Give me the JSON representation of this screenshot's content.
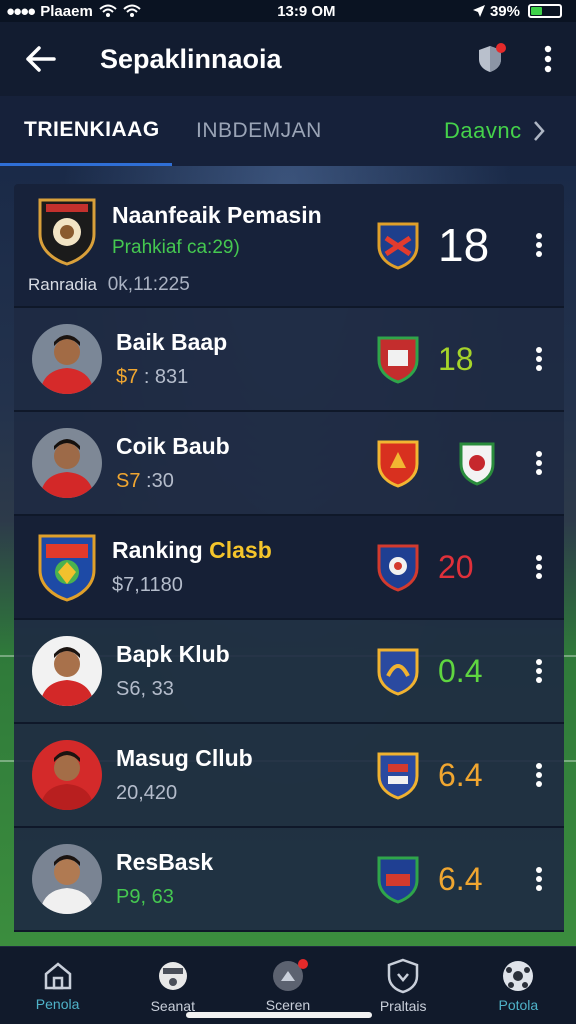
{
  "status": {
    "carrier": "Plaaem",
    "time": "13:9 OM",
    "battery": "39%",
    "battery_level": 0.39
  },
  "appbar": {
    "title": "Sepaklinnaoia",
    "notification_badge": true
  },
  "tabs": [
    {
      "label": "TRIENKIAAG",
      "active": true
    },
    {
      "label": "INBDEMJAN",
      "active": false
    }
  ],
  "tab_link": "Daavnc",
  "list": {
    "featured": {
      "name": "Naanfeaik Pemasin",
      "subtitle": "Prahkiaf ca:29)",
      "footer_label": "Ranradia",
      "footer_value": "0k,11:225",
      "score": "18",
      "score_color": "#ffffff"
    },
    "rows": [
      {
        "name": "Baik Baap",
        "sub_prefix": "$7",
        "sub_value": ": 831",
        "score": "18",
        "score_color": "#a6d42a"
      },
      {
        "name": "Coik Baub",
        "sub_prefix": "S7",
        "sub_value": ":30",
        "score": "",
        "score_color": "#ffffff"
      },
      {
        "name": "Ranking ",
        "name_highlight": "Clasb",
        "sub_prefix": "",
        "sub_value": "$7,1180",
        "score": "20",
        "score_color": "#e0303a"
      },
      {
        "name": "Bapk Klub",
        "sub_prefix": "",
        "sub_value": "S6, 33",
        "score": "0.4",
        "score_color": "#5fd640"
      },
      {
        "name": "Masug Cllub",
        "sub_prefix": "",
        "sub_value": "20,420",
        "score": "6.4",
        "score_color": "#f0a630"
      },
      {
        "name": "ResBask",
        "sub_prefix": "",
        "sub_value": "P9, 63",
        "score": "6.4",
        "score_color": "#f0a630"
      }
    ]
  },
  "bottom_nav": [
    {
      "label": "Penola",
      "icon": "home-icon",
      "active": true
    },
    {
      "label": "Seanat",
      "icon": "whistle-icon",
      "active": false
    },
    {
      "label": "Sceren",
      "icon": "ball-icon",
      "active": false
    },
    {
      "label": "Praltais",
      "icon": "shield-icon",
      "active": false
    },
    {
      "label": "Potola",
      "icon": "soccer-ball-icon",
      "active": true
    }
  ]
}
